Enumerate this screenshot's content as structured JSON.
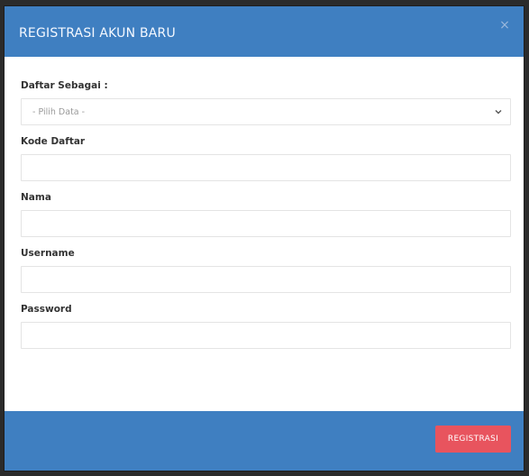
{
  "modal": {
    "title": "REGISTRASI AKUN BARU",
    "close_symbol": "×",
    "colors": {
      "header": "#3f7fc1",
      "footer": "#3f7fc1",
      "button": "#e8545e"
    }
  },
  "form": {
    "role": {
      "label": "Daftar Sebagai :",
      "selected": "- Pilih Data -",
      "icon": "chevron-down-icon"
    },
    "code": {
      "label": "Kode Daftar",
      "value": ""
    },
    "name": {
      "label": "Nama",
      "value": ""
    },
    "username": {
      "label": "Username",
      "value": ""
    },
    "password": {
      "label": "Password",
      "value": ""
    }
  },
  "footer": {
    "submit_label": "REGISTRASI"
  }
}
